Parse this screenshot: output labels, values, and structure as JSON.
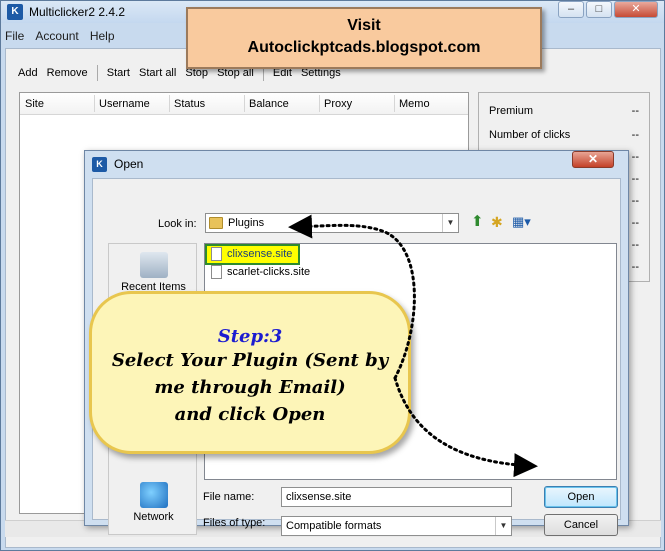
{
  "app": {
    "title": "Multiclicker2 2.4.2",
    "icon_glyph": "K",
    "controls": {
      "minimize": "–",
      "maximize": "□",
      "close": "✕"
    }
  },
  "menu": [
    "File",
    "Account",
    "Help"
  ],
  "toolbar": {
    "group1": [
      "Add",
      "Remove"
    ],
    "group2": [
      "Start",
      "Start all",
      "Stop",
      "Stop all"
    ],
    "group3": [
      "Edit",
      "Settings"
    ]
  },
  "grid": {
    "columns": [
      "Site",
      "Username",
      "Status",
      "Balance",
      "Proxy",
      "Memo"
    ]
  },
  "stats": [
    {
      "label": "Premium",
      "value": "--"
    },
    {
      "label": "Number of clicks",
      "value": "--"
    },
    {
      "label": "",
      "value": "--"
    },
    {
      "label": "",
      "value": "--"
    },
    {
      "label": "",
      "value": "--"
    },
    {
      "label": "",
      "value": "--"
    },
    {
      "label": "",
      "value": "--"
    },
    {
      "label": "",
      "value": "--"
    }
  ],
  "banner": {
    "line1": "Visit",
    "line2": "Autoclickptcads.blogspot.com"
  },
  "dialog": {
    "title": "Open",
    "icon_glyph": "K",
    "close_label": "✕",
    "look_in_label": "Look in:",
    "look_in_value": "Plugins",
    "places": [
      {
        "label": "Recent Items",
        "icon": "recent-items-icon"
      },
      {
        "label": "Network",
        "icon": "network-icon"
      }
    ],
    "files": [
      "clixsense.site",
      "scarlet-clicks.site"
    ],
    "file_name_label": "File name:",
    "file_name_value": "clixsense.site",
    "file_type_label": "Files of type:",
    "file_type_value": "Compatible formats",
    "open_label": "Open",
    "cancel_label": "Cancel"
  },
  "callout": {
    "step": "Step:3",
    "line1": "Select Your Plugin (Sent by",
    "line2": "me through Email)",
    "line3": "and click Open"
  },
  "colors": {
    "highlight": "#ffff00",
    "callout_bg": "#fdf5b8",
    "banner_bg": "#f9ca9e",
    "step_text": "#1c1cd0"
  }
}
